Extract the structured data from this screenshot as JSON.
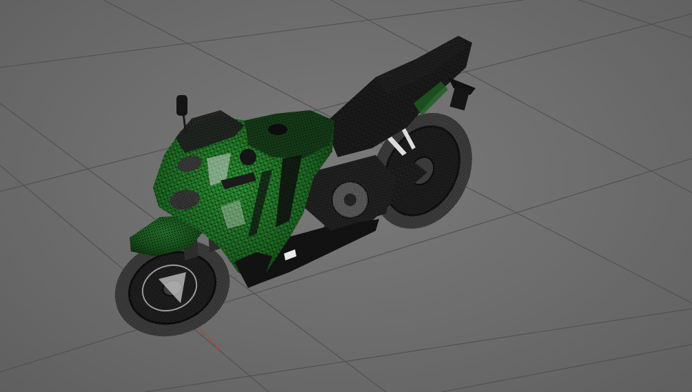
{
  "viewport": {
    "label": "3D viewport",
    "background_color": "#6e6e6e",
    "grid_color": "#4f4f4f"
  },
  "model": {
    "object": "motorcycle",
    "display_mode": "wireframe-on-shaded",
    "body_color": "#1e7a25",
    "wire_color": "#0c0c0c",
    "accent_color": "#c8c8c8"
  },
  "world_axis": {
    "x_axis_color": "#d0342c"
  }
}
